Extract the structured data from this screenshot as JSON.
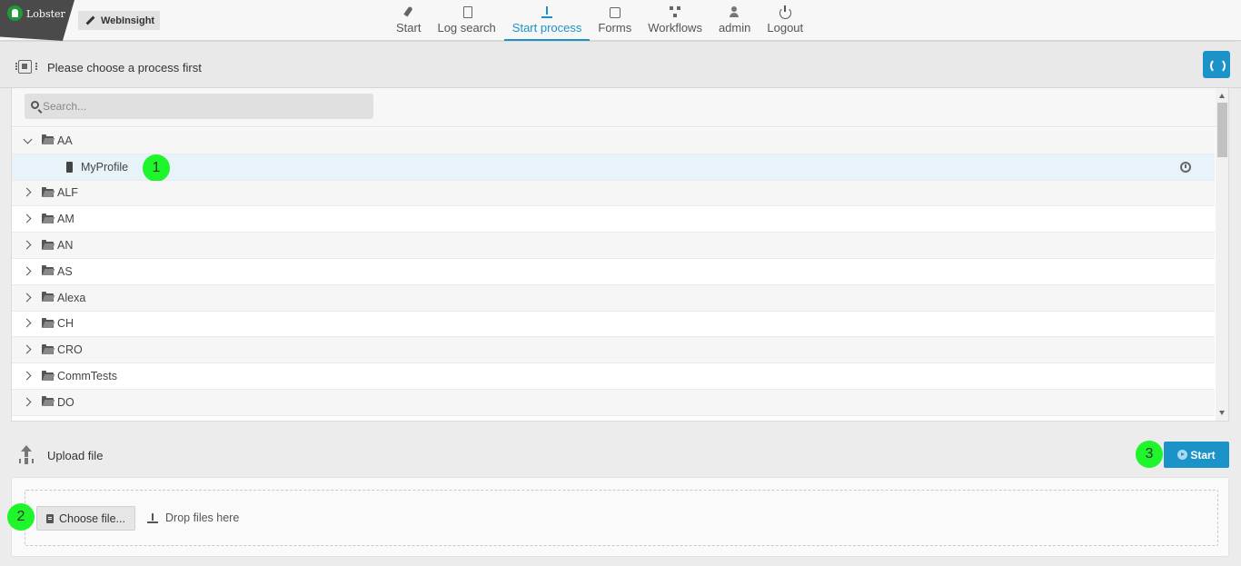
{
  "brand": {
    "logo_text": "Lobster",
    "app_name": "WebInsight"
  },
  "nav": [
    {
      "label": "Start",
      "icon": "rocket-icon",
      "active": false
    },
    {
      "label": "Log search",
      "icon": "log-search-icon",
      "active": false
    },
    {
      "label": "Start process",
      "icon": "upload-icon",
      "active": true
    },
    {
      "label": "Forms",
      "icon": "form-edit-icon",
      "active": false
    },
    {
      "label": "Workflows",
      "icon": "workflow-icon",
      "active": false
    },
    {
      "label": "admin",
      "icon": "user-gear-icon",
      "active": false
    },
    {
      "label": "Logout",
      "icon": "power-icon",
      "active": false
    }
  ],
  "header": {
    "title": "Please choose a process first",
    "icon": "chip-icon",
    "refresh_icon": "refresh-icon"
  },
  "search": {
    "placeholder": "Search..."
  },
  "tree": [
    {
      "label": "AA",
      "type": "folder",
      "expanded": true
    },
    {
      "label": "MyProfile",
      "type": "profile",
      "selected": true
    },
    {
      "label": "ALF",
      "type": "folder",
      "expanded": false
    },
    {
      "label": "AM",
      "type": "folder",
      "expanded": false
    },
    {
      "label": "AN",
      "type": "folder",
      "expanded": false
    },
    {
      "label": "AS",
      "type": "folder",
      "expanded": false
    },
    {
      "label": "Alexa",
      "type": "folder",
      "expanded": false
    },
    {
      "label": "CH",
      "type": "folder",
      "expanded": false
    },
    {
      "label": "CRO",
      "type": "folder",
      "expanded": false
    },
    {
      "label": "CommTests",
      "type": "folder",
      "expanded": false
    },
    {
      "label": "DO",
      "type": "folder",
      "expanded": false
    }
  ],
  "upload": {
    "title": "Upload file",
    "start_label": "Start",
    "choose_label": "Choose file...",
    "drop_hint": "Drop files here"
  },
  "markers": [
    "1",
    "2",
    "3"
  ],
  "colors": {
    "accent": "#1b93c8",
    "marker": "#1ef52a",
    "selected_row": "#e7f3f8"
  }
}
